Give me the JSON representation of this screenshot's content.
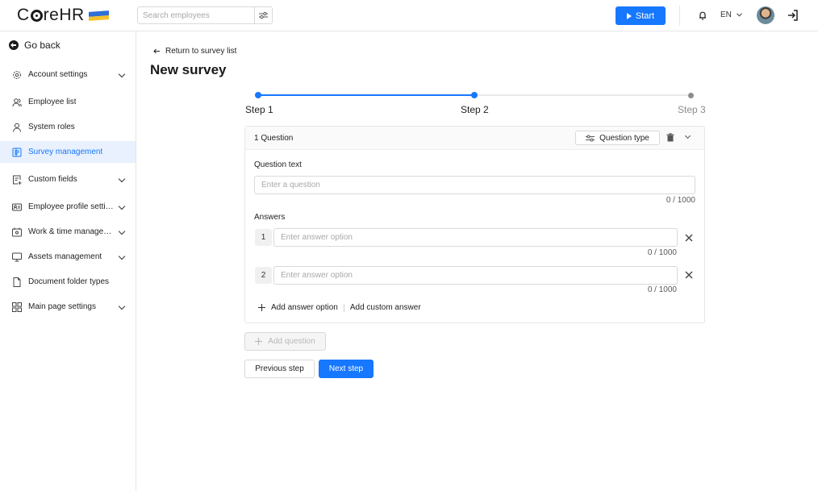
{
  "header": {
    "logo": "CoreHR",
    "search_placeholder": "Search employees",
    "start_label": "Start",
    "language": "EN"
  },
  "sidebar": {
    "go_back": "Go back",
    "items": [
      {
        "label": "Account settings",
        "icon": "gear-icon",
        "expandable": true,
        "active": false
      },
      {
        "label": "Employee list",
        "icon": "users-icon",
        "expandable": false,
        "active": false
      },
      {
        "label": "System roles",
        "icon": "user-icon",
        "expandable": false,
        "active": false
      },
      {
        "label": "Survey management",
        "icon": "survey-icon",
        "expandable": false,
        "active": true
      },
      {
        "label": "Custom fields",
        "icon": "form-icon",
        "expandable": true,
        "active": false
      },
      {
        "label": "Employee profile settings",
        "icon": "id-card-icon",
        "expandable": true,
        "active": false
      },
      {
        "label": "Work & time management",
        "icon": "calendar-icon",
        "expandable": true,
        "active": false
      },
      {
        "label": "Assets management",
        "icon": "monitor-icon",
        "expandable": true,
        "active": false
      },
      {
        "label": "Document folder types",
        "icon": "document-icon",
        "expandable": false,
        "active": false
      },
      {
        "label": "Main page settings",
        "icon": "grid-icon",
        "expandable": true,
        "active": false
      }
    ]
  },
  "main": {
    "return_link": "Return to survey list",
    "title": "New survey",
    "steps": [
      "Step 1",
      "Step 2",
      "Step 3"
    ],
    "current_step": 2,
    "colors": {
      "accent": "#1677ff",
      "inactive": "#e8e8e8",
      "active_bg": "#e8f1fd"
    },
    "question_card": {
      "title": "1 Question",
      "question_type_label": "Question type",
      "question_text_label": "Question text",
      "question_placeholder": "Enter a question",
      "question_counter": "0 / 1000",
      "answers_label": "Answers",
      "answers": [
        {
          "number": "1",
          "placeholder": "Enter answer option",
          "counter": "0 / 1000"
        },
        {
          "number": "2",
          "placeholder": "Enter answer option",
          "counter": "0 / 1000"
        }
      ],
      "add_answer_option": "Add answer option",
      "add_custom_answer": "Add custom answer"
    },
    "add_question_label": "Add question",
    "previous_step_label": "Previous step",
    "next_step_label": "Next step"
  }
}
